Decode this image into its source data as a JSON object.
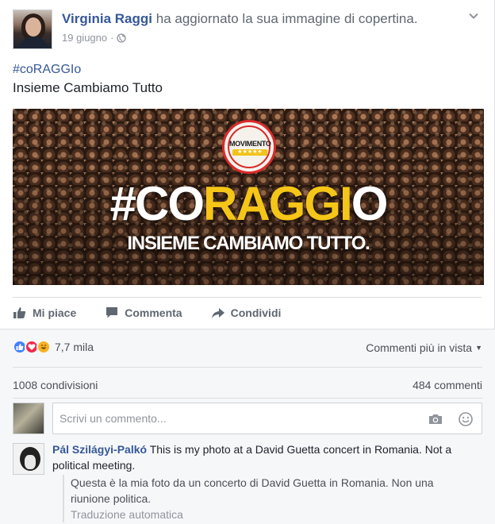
{
  "post": {
    "author": "Virginia Raggi",
    "action": "ha aggiornato la sua immagine di copertina.",
    "date": "19 giugno",
    "separator": "·",
    "hashtag": "#coRAGGIo",
    "text": "Insieme Cambiamo Tutto",
    "icons": [
      "globe-icon",
      "chevron-down-icon"
    ]
  },
  "cover": {
    "logo_word": "MOVIMENTO",
    "logo_stars": "★★★★★",
    "headline_white1": "#CO",
    "headline_yellow": "RAGGI",
    "headline_white2": "O",
    "subline": "INSIEME CAMBIAMO TUTTO.",
    "accent_yellow": "#f5c518",
    "logo_red": "#d92b2b"
  },
  "actions": {
    "like": "Mi piace",
    "comment": "Commenta",
    "share": "Condividi"
  },
  "stats": {
    "reactions_count": "7,7 mila",
    "sort_label": "Commenti più in vista",
    "shares": "1008 condivisioni",
    "comments": "484 commenti"
  },
  "composer": {
    "placeholder": "Scrivi un commento...",
    "icons": [
      "camera-icon",
      "emoji-icon"
    ]
  },
  "comment": {
    "author": "Pál Szilágyi-Palkó",
    "text": "This is my photo at a David Guetta concert in Romania. Not a political meeting.",
    "translation": "Questa è la mia foto da un concerto di David Guetta in Romania. Non una riunione politica.",
    "translation_label": "Traduzione automatica"
  },
  "colors": {
    "link_blue": "#365899",
    "like_blue": "#4080ff",
    "love_red": "#f0284a",
    "haha_yellow": "#f7b125"
  }
}
